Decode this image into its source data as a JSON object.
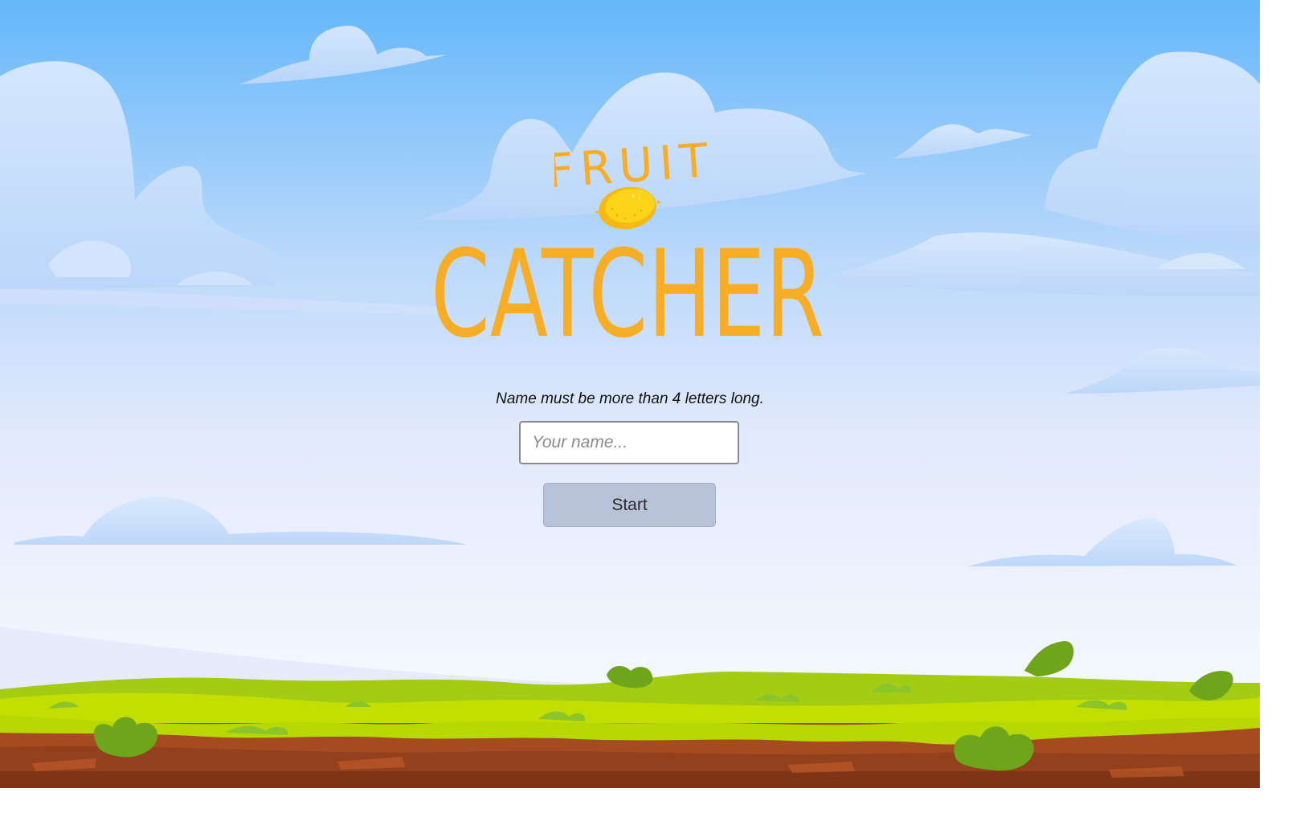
{
  "game": {
    "logo": {
      "top_word": "FRUIT",
      "main_word": "CATCHER",
      "mascot_icon": "lemon-icon"
    },
    "login": {
      "hint": "Name must be more than 4 letters long.",
      "name_placeholder": "Your name...",
      "name_value": "",
      "start_label": "Start"
    }
  },
  "colors": {
    "sky_top": "#64b7fb",
    "sky_bottom": "#f3f7fe",
    "logo_orange": "#f8ad27",
    "lemon_yellow": "#fbd41a",
    "grass_light": "#c3de01",
    "grass_dark": "#6ea51a",
    "soil": "#a64a22",
    "button_bg": "#b8c3da"
  }
}
